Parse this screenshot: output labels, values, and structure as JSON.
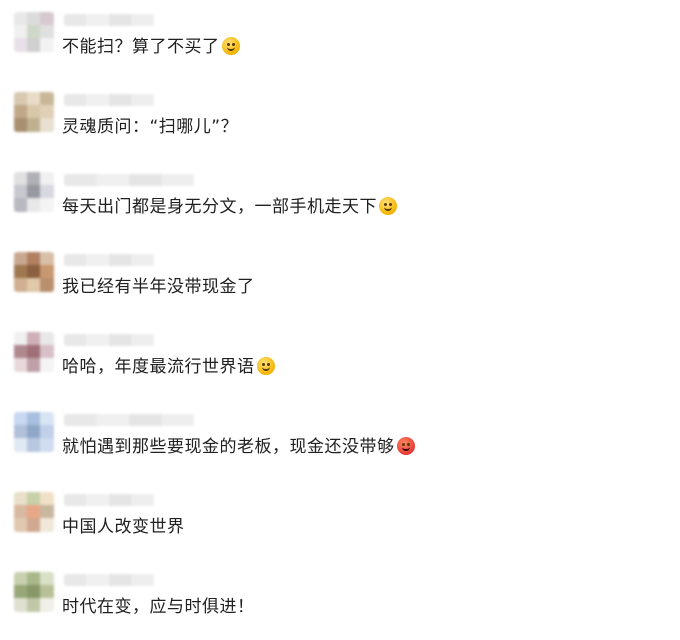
{
  "comments": [
    {
      "text": "不能扫？算了不买了",
      "emoji": "laugh-cry-emoji",
      "avatar_colors": [
        "#e8e8e8",
        "#dcdcdc",
        "#d8c8d0",
        "#f0f0f0",
        "#cfd8c8",
        "#e0e0e0",
        "#e8e0e8",
        "#d0d0d0",
        "#f2f2f2"
      ]
    },
    {
      "text": "灵魂质问：“扫哪儿”？",
      "emoji": null,
      "avatar_colors": [
        "#d8c8b0",
        "#e8dcc8",
        "#c8b898",
        "#bfa888",
        "#d8c8a8",
        "#e0d0b8",
        "#a89070",
        "#c0b090",
        "#e8e0d0"
      ]
    },
    {
      "text": "每天出门都是身无分文，一部手机走天下",
      "emoji": "grin-emoji",
      "avatar_colors": [
        "#e0e0e0",
        "#b0b0b8",
        "#f0f0f0",
        "#c8c8d0",
        "#9898a0",
        "#d8d8e0",
        "#b8b8c0",
        "#e8e8e8",
        "#f4f4f4"
      ]
    },
    {
      "text": "我已经有半年没带现金了",
      "emoji": null,
      "avatar_colors": [
        "#c8a890",
        "#b08060",
        "#d8c0a8",
        "#a07850",
        "#8a6040",
        "#c89870",
        "#d0b090",
        "#e0c8a8",
        "#b89070"
      ]
    },
    {
      "text": "哈哈，年度最流行世界语",
      "emoji": "thinking-emoji",
      "avatar_colors": [
        "#f0f0f0",
        "#d0b0b8",
        "#e8e8e8",
        "#b08890",
        "#a07078",
        "#d8c0c8",
        "#e8d8dc",
        "#c0a0a8",
        "#f4f4f4"
      ]
    },
    {
      "text": "就怕遇到那些要现金的老板，现金还没带够",
      "emoji": "angry-emoji",
      "avatar_colors": [
        "#c8d8f0",
        "#a8c0e0",
        "#d8e4f4",
        "#b0c0d8",
        "#90a8c8",
        "#c0d0e8",
        "#e0e8f4",
        "#b8c8e0",
        "#d0dcf0"
      ]
    },
    {
      "text": "中国人改变世界",
      "emoji": null,
      "avatar_colors": [
        "#e8e0c8",
        "#c8d0a8",
        "#f0e0c8",
        "#d8b8a0",
        "#e8a888",
        "#c8b8a0",
        "#e0c8b0",
        "#d0a890",
        "#f0e8d8"
      ]
    },
    {
      "text": "时代在变，应与时俱进！",
      "emoji": null,
      "avatar_colors": [
        "#c8d0b0",
        "#a8b888",
        "#d8e0c8",
        "#98a878",
        "#889868",
        "#b8c098",
        "#e0e0d0",
        "#c0c8a8",
        "#f0f0e8"
      ]
    }
  ]
}
